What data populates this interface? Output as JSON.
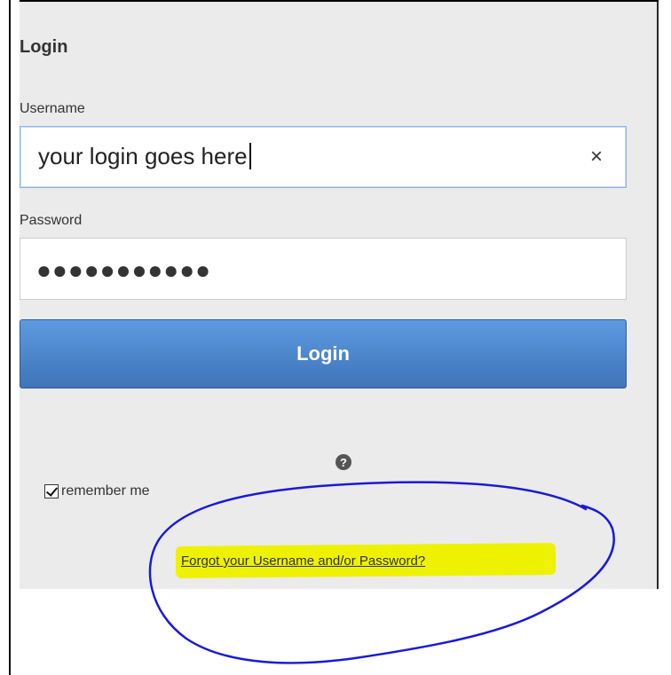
{
  "panel": {
    "title": "Login"
  },
  "username": {
    "label": "Username",
    "value": "your login goes here",
    "clear_glyph": "×"
  },
  "password": {
    "label": "Password",
    "masked_value": "●●●●●●●●●●●"
  },
  "login_button": {
    "label": "Login"
  },
  "help": {
    "glyph": "?"
  },
  "remember_me": {
    "label": "remember me",
    "checked": true
  },
  "forgot_link": {
    "label": "Forgot your Username and/or Password?"
  },
  "annotation": {
    "highlight_color": "#eef200",
    "circle_color": "#1a1ad6"
  }
}
